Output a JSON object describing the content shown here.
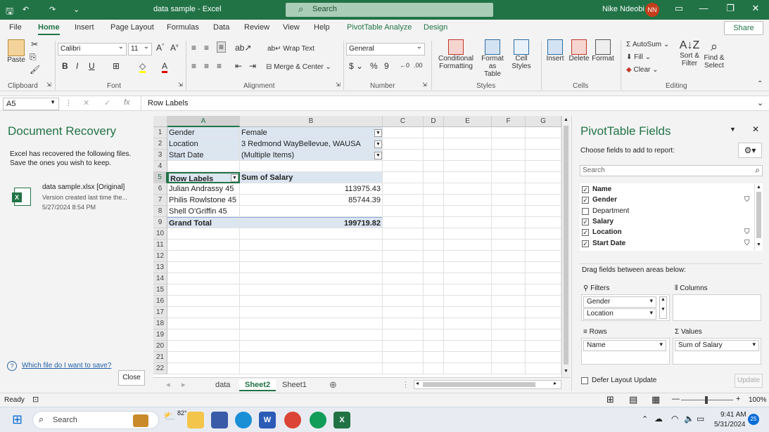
{
  "titlebar": {
    "doc_title": "data sample - Excel",
    "search_label": "Search",
    "user_name": "Nike Ndeobi",
    "user_initials": "NN"
  },
  "menu": {
    "tabs": [
      "File",
      "Home",
      "Insert",
      "Page Layout",
      "Formulas",
      "Data",
      "Review",
      "View",
      "Help",
      "PivotTable Analyze",
      "Design"
    ],
    "share": "Share"
  },
  "ribbon": {
    "clipboard": {
      "label": "Clipboard",
      "paste": "Paste"
    },
    "font": {
      "label": "Font",
      "family": "Calibri",
      "size": "11"
    },
    "alignment": {
      "label": "Alignment",
      "wrap": "Wrap Text",
      "merge": "Merge & Center"
    },
    "number": {
      "label": "Number",
      "format": "General"
    },
    "styles": {
      "label": "Styles",
      "cond1": "Conditional",
      "cond2": "Formatting",
      "fmt1": "Format as",
      "fmt2": "Table",
      "cell1": "Cell",
      "cell2": "Styles"
    },
    "cells": {
      "label": "Cells",
      "insert": "Insert",
      "delete": "Delete",
      "format": "Format"
    },
    "editing": {
      "label": "Editing",
      "autosum": "AutoSum",
      "fill": "Fill",
      "clear": "Clear",
      "sort1": "Sort &",
      "sort2": "Filter",
      "find1": "Find &",
      "find2": "Select"
    }
  },
  "formula": {
    "name_box": "A5",
    "content": "Row Labels"
  },
  "recovery": {
    "title": "Document Recovery",
    "message": "Excel has recovered the following files. Save the ones you wish to keep.",
    "file_name": "data sample.xlsx  [Original]",
    "file_desc": "Version created last time the...",
    "file_date": "5/27/2024 8:54 PM",
    "help_link": "Which file do I want to save?",
    "close": "Close"
  },
  "grid": {
    "columns": [
      "A",
      "B",
      "C",
      "D",
      "E",
      "F",
      "G"
    ],
    "rows": [
      "1",
      "2",
      "3",
      "4",
      "5",
      "6",
      "7",
      "8",
      "9",
      "10",
      "11",
      "12",
      "13",
      "14",
      "15",
      "16",
      "17",
      "18",
      "19",
      "20",
      "21",
      "22"
    ],
    "filters": [
      {
        "field": "Gender",
        "value": "Female"
      },
      {
        "field": "Location",
        "value": "3 Redmond WayBellevue, WAUSA"
      },
      {
        "field": "Start Date",
        "value": "(Multiple Items)"
      }
    ],
    "pivot_header": {
      "row_labels": "Row Labels",
      "sum": "Sum of Salary"
    },
    "pivot_rows": [
      {
        "name": "Julian Andrassy 45",
        "value": "113975.43"
      },
      {
        "name": "Philis Rowlstone 45",
        "value": "85744.39"
      },
      {
        "name": "Shell O'Griffin 45",
        "value": ""
      }
    ],
    "grand_total": {
      "label": "Grand Total",
      "value": "199719.82"
    }
  },
  "sheets": [
    "data",
    "Sheet2",
    "Sheet1"
  ],
  "active_sheet": "Sheet2",
  "pivot_pane": {
    "title": "PivotTable Fields",
    "choose": "Choose fields to add to report:",
    "search_placeholder": "Search",
    "fields": [
      {
        "name": "Name",
        "checked": true,
        "filter": false
      },
      {
        "name": "Gender",
        "checked": true,
        "filter": true
      },
      {
        "name": "Department",
        "checked": false,
        "filter": false
      },
      {
        "name": "Salary",
        "checked": true,
        "filter": false
      },
      {
        "name": "Location",
        "checked": true,
        "filter": true
      },
      {
        "name": "Start Date",
        "checked": true,
        "filter": true
      }
    ],
    "drag_hint": "Drag fields between areas below:",
    "areas": {
      "filters_label": "Filters",
      "filters": [
        "Gender",
        "Location"
      ],
      "columns_label": "Columns",
      "rows_label": "Rows",
      "rows": [
        "Name"
      ],
      "values_label": "Values",
      "values": [
        "Sum of Salary"
      ]
    },
    "defer": "Defer Layout Update",
    "update": "Update"
  },
  "status": {
    "ready": "Ready",
    "zoom": "100%"
  },
  "taskbar": {
    "search": "Search",
    "temp": "82°",
    "time": "9:41 AM",
    "date": "5/31/2024",
    "notif": "25"
  },
  "colors": {
    "excel_green": "#217346",
    "pivot_fill": "#dce6f1"
  }
}
